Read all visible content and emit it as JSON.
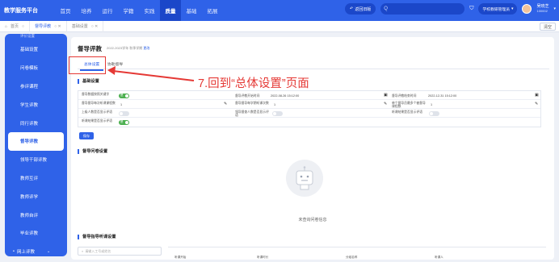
{
  "topbar": {
    "brand": "教学服务平台",
    "nav": [
      "首页",
      "培养",
      "运行",
      "学籍",
      "实践",
      "质量",
      "基础",
      "拓展"
    ],
    "active_nav": "质量",
    "back_label": "返回旧版",
    "search_placeholder": "Q",
    "user_select": "学校教研管理员",
    "user_name": "吴晓芝",
    "user_id": "100002",
    "colors": {
      "primary": "#2f62e8",
      "primary_dark": "#1b47c9",
      "annotation": "#e53935"
    }
  },
  "tabs": {
    "items": [
      {
        "label": "首页",
        "icon": "home-icon"
      },
      {
        "label": "督导评教"
      },
      {
        "label": "基础设置"
      }
    ],
    "right_button": "清空"
  },
  "sidebar": {
    "items": [
      "评价设置",
      "基础设置",
      "问卷模板",
      "参评课程",
      "学生评教",
      "同行评教",
      "督导评教",
      "领导干部评教",
      "教师互评",
      "教师评学",
      "教师自评",
      "毕业评教",
      "网上评教"
    ],
    "active": "督导评教"
  },
  "main": {
    "title": "督导评教",
    "semester": "2022-2023学年 秋季学期",
    "semester_link": "更改",
    "subtabs": [
      "总体设置",
      "协助督导"
    ],
    "section_basic": "基础设置",
    "rows": [
      [
        {
          "label": "督导数据按照关键字",
          "type": "toggle",
          "value": "是"
        },
        {
          "label": "督导评教开始时间",
          "type": "date",
          "value": "2022-08-26 15:12:00"
        },
        {
          "label": "督导评教结束时间",
          "type": "date",
          "value": "2022-12-31 15:12:00"
        }
      ],
      [
        {
          "label": "督导督导每次听课课程数",
          "type": "input",
          "value": "1"
        },
        {
          "label": "督导督导每学期听课次数",
          "type": "input",
          "value": "1"
        },
        {
          "label": "单个督导员最多个被督导课程数",
          "type": "input",
          "value": "1"
        }
      ],
      [
        {
          "label": "上级人数是否显示评语",
          "type": "toggle",
          "value": ""
        },
        {
          "label": "领导督查人数是否显示评语",
          "type": "toggle",
          "value": ""
        },
        {
          "label": "听课结果是否显示评语",
          "type": "toggle",
          "value": ""
        }
      ],
      [
        {
          "label": "听课结果是否显示评语",
          "type": "toggle",
          "value": "是"
        }
      ]
    ],
    "save_label": "保存",
    "section_questionnaire": "督导问卷设置",
    "empty_text": "未查询问卷信息",
    "section_teachers": "督导指导听课设置",
    "search_placeholder": "请输入工号或姓名",
    "bottom_labels": [
      "听课开始",
      "听课时长",
      "分组名称",
      "听课人"
    ]
  },
  "annotation": {
    "text": "7.回到“总体设置”页面"
  }
}
